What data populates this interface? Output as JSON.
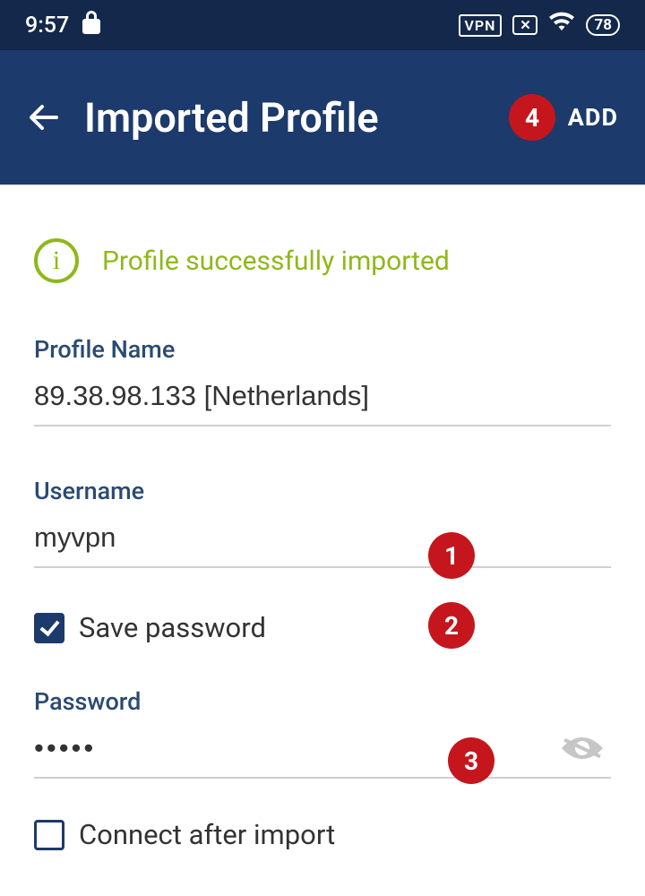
{
  "statusbar": {
    "time": "9:57",
    "vpn_label": "VPN",
    "battery": "78"
  },
  "appbar": {
    "title": "Imported Profile",
    "add_label": "ADD"
  },
  "success_message": "Profile successfully imported",
  "fields": {
    "profile_name": {
      "label": "Profile Name",
      "value": "89.38.98.133 [Netherlands]"
    },
    "username": {
      "label": "Username",
      "value": "myvpn"
    },
    "save_password": {
      "label": "Save password",
      "checked": true
    },
    "password": {
      "label": "Password",
      "value": "•••••"
    },
    "connect_after": {
      "label": "Connect after import",
      "checked": false
    }
  },
  "badges": {
    "b1": "1",
    "b2": "2",
    "b3": "3",
    "b4": "4"
  }
}
